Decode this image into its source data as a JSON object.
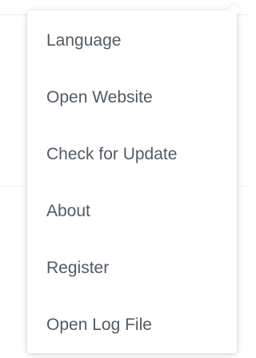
{
  "menu": {
    "items": [
      {
        "label": "Language"
      },
      {
        "label": "Open Website"
      },
      {
        "label": "Check for Update"
      },
      {
        "label": "About"
      },
      {
        "label": "Register"
      },
      {
        "label": "Open Log File"
      }
    ]
  }
}
